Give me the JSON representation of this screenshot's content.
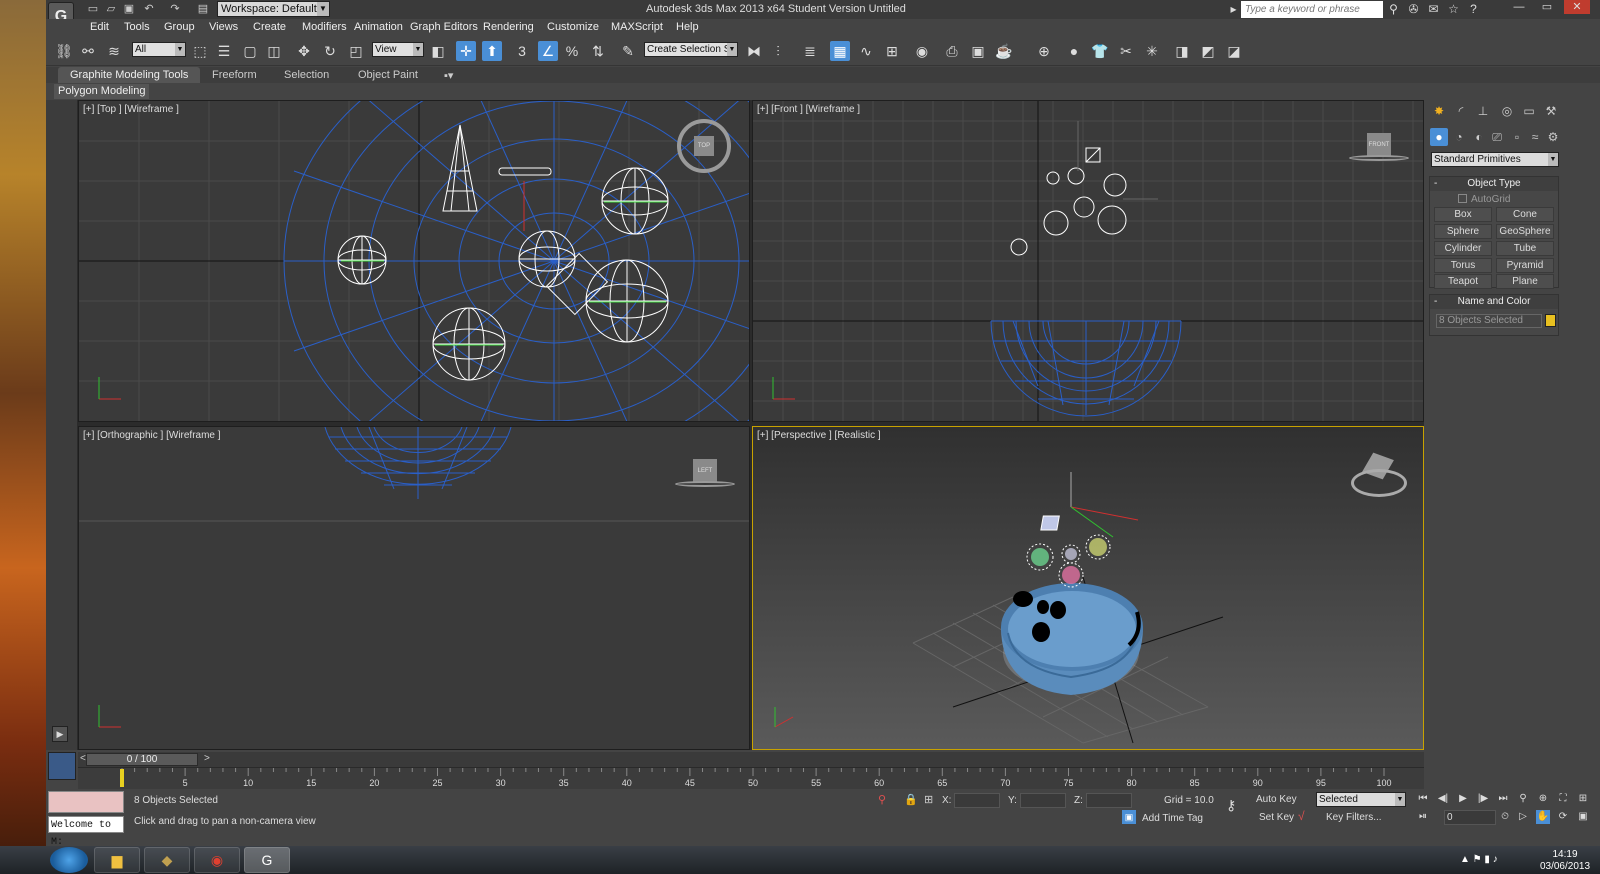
{
  "window": {
    "title": "Autodesk 3ds Max  2013 x64     Student Version    Untitled",
    "workspace": "Workspace: Default",
    "search_placeholder": "Type a keyword or phrase"
  },
  "menu": [
    "Edit",
    "Tools",
    "Group",
    "Views",
    "Create",
    "Modifiers",
    "Animation",
    "Graph Editors",
    "Rendering",
    "Customize",
    "MAXScript",
    "Help"
  ],
  "toolbar": {
    "filter": "All",
    "ref_coord": "View",
    "selection_set": "Create Selection Se",
    "snap_label": "3"
  },
  "ribbon": {
    "tabs": [
      "Graphite Modeling Tools",
      "Freeform",
      "Selection",
      "Object Paint"
    ],
    "subtab": "Polygon Modeling"
  },
  "viewports": {
    "top": "[+] [Top ] [Wireframe ]",
    "front": "[+] [Front ] [Wireframe ]",
    "ortho": "[+] [Orthographic ] [Wireframe ]",
    "persp": "[+] [Perspective ] [Realistic ]"
  },
  "navcube": {
    "top": "TOP",
    "front": "FRONT",
    "left": "LEFT"
  },
  "command_panel": {
    "category": "Standard Primitives",
    "object_type_title": "Object Type",
    "autogrid": "AutoGrid",
    "primitives": [
      "Box",
      "Cone",
      "Sphere",
      "GeoSphere",
      "Cylinder",
      "Tube",
      "Torus",
      "Pyramid",
      "Teapot",
      "Plane"
    ],
    "name_color_title": "Name and Color",
    "name_value": "8 Objects Selected",
    "color": "#e8c020"
  },
  "timeline": {
    "frame_counter": "0 / 100",
    "ticks": [
      "5",
      "10",
      "15",
      "20",
      "25",
      "30",
      "35",
      "40",
      "45",
      "50",
      "55",
      "60",
      "65",
      "70",
      "75",
      "80",
      "85",
      "90",
      "95",
      "100"
    ]
  },
  "status": {
    "selection": "8 Objects Selected",
    "prompt": "Click and drag to pan a non-camera view",
    "welcome": "Welcome to M:",
    "x_label": "X:",
    "y_label": "Y:",
    "z_label": "Z:",
    "grid": "Grid = 10.0",
    "add_time_tag": "Add Time Tag",
    "auto_key": "Auto Key",
    "set_key": "Set Key",
    "key_mode": "Selected",
    "key_filters": "Key Filters...",
    "current_frame": "0"
  },
  "taskbar": {
    "time": "14:19",
    "date": "03/06/2013"
  }
}
